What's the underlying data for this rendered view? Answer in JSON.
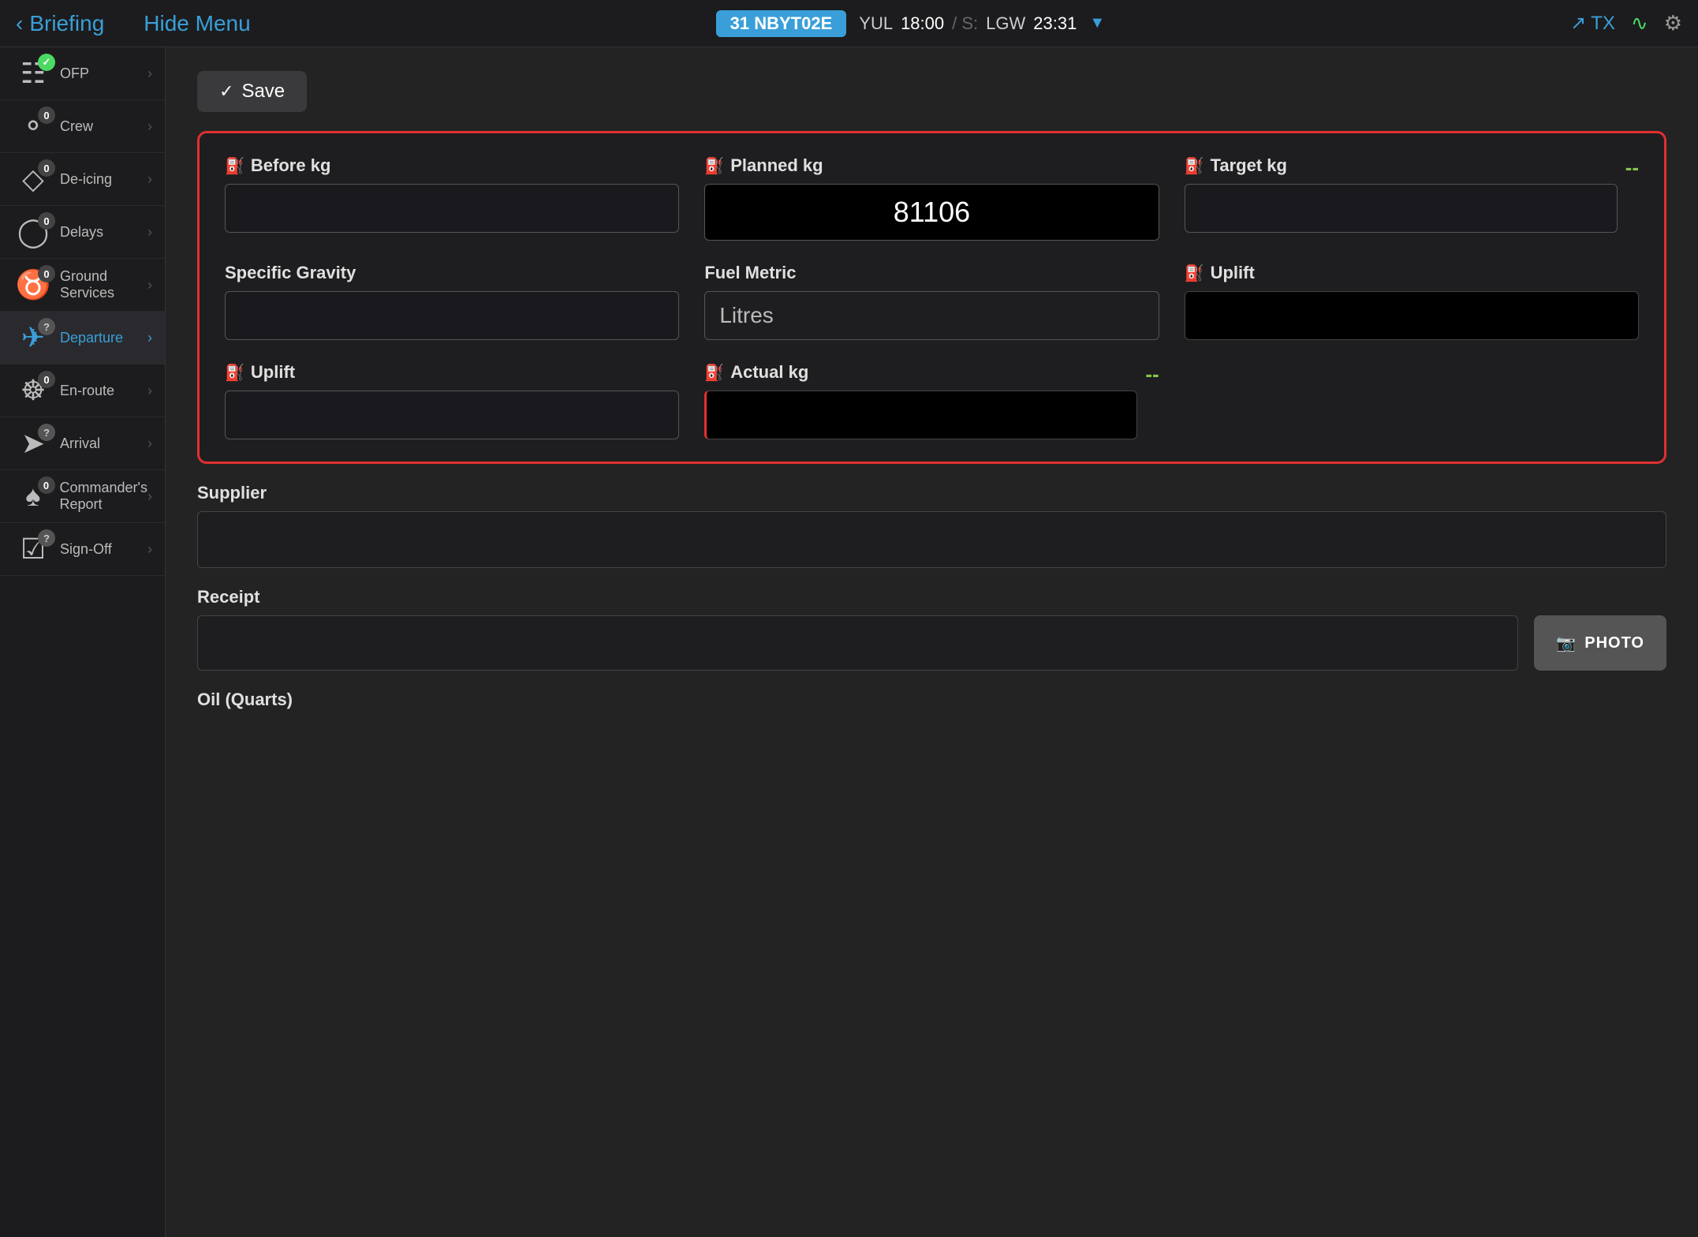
{
  "topbar": {
    "back_label": "Briefing",
    "hide_menu_label": "Hide Menu",
    "flight_badge": "31 NBYT02E",
    "origin_airport": "YUL",
    "origin_time": "18:00",
    "separator": "/ S:",
    "slash": "/",
    "dest_airport": "LGW",
    "dest_time": "23:31",
    "tx_label": "TX"
  },
  "sidebar": {
    "items": [
      {
        "id": "ofp",
        "label": "OFP",
        "badge": "check",
        "badge_type": "green",
        "icon": "📋"
      },
      {
        "id": "crew",
        "label": "Crew",
        "badge": "0",
        "badge_type": "normal",
        "icon": "👤"
      },
      {
        "id": "deicing",
        "label": "De-icing",
        "badge": "0",
        "badge_type": "normal",
        "icon": "💎"
      },
      {
        "id": "delays",
        "label": "Delays",
        "badge": "0",
        "badge_type": "normal",
        "icon": "🕐"
      },
      {
        "id": "ground",
        "label": "Ground Services",
        "badge": "0",
        "badge_type": "normal",
        "icon": "🗂"
      },
      {
        "id": "departure",
        "label": "Departure",
        "badge": "?",
        "badge_type": "question",
        "icon": "✈",
        "active": true
      },
      {
        "id": "enroute",
        "label": "En-route",
        "badge": "0",
        "badge_type": "normal",
        "icon": "🗺"
      },
      {
        "id": "arrival",
        "label": "Arrival",
        "badge": "?",
        "badge_type": "question",
        "icon": "⚡"
      },
      {
        "id": "commanders",
        "label": "Commander's Report",
        "badge": "0",
        "badge_type": "normal",
        "icon": "👤"
      },
      {
        "id": "signoff",
        "label": "Sign-Off",
        "badge": "?",
        "badge_type": "question",
        "icon": "✅"
      }
    ]
  },
  "toolbar": {
    "save_label": "Save"
  },
  "fuel_panel": {
    "before_kg_label": "Before kg",
    "planned_kg_label": "Planned kg",
    "target_kg_label": "Target kg",
    "planned_kg_value": "81106",
    "specific_gravity_label": "Specific Gravity",
    "fuel_metric_label": "Fuel Metric",
    "fuel_metric_value": "Litres",
    "uplift_label_1": "Uplift",
    "uplift_label_2": "Uplift",
    "actual_kg_label": "Actual kg",
    "dash_1": "--",
    "dash_2": "--"
  },
  "supplier": {
    "label": "Supplier",
    "placeholder": ""
  },
  "receipt": {
    "label": "Receipt",
    "photo_label": "PHOTO"
  },
  "oil": {
    "label": "Oil (Quarts)"
  }
}
